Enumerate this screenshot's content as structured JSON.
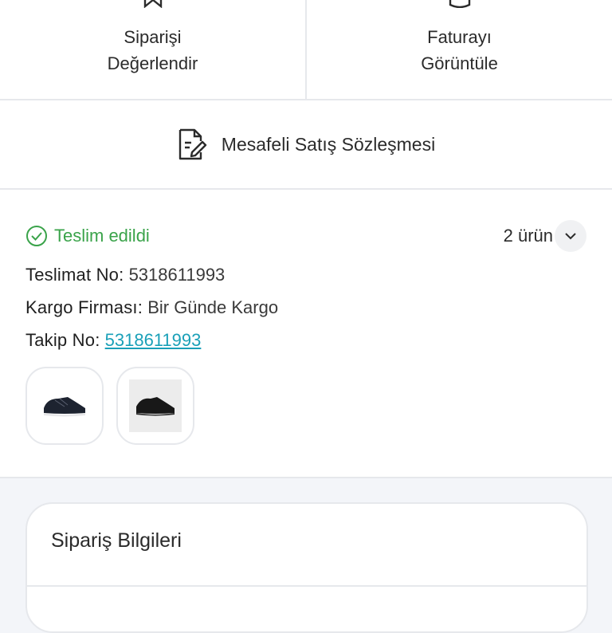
{
  "actions": {
    "rate": {
      "line1": "Siparişi",
      "line2": "Değerlendir",
      "icon": "bookmark-icon"
    },
    "invoice": {
      "line1": "Faturayı",
      "line2": "Görüntüle",
      "icon": "receipt-icon"
    }
  },
  "contract": {
    "label": "Mesafeli Satış Sözleşmesi",
    "icon": "document-edit-icon"
  },
  "shipment": {
    "status": "Teslim edildi",
    "status_color": "#3aa34a",
    "item_count": "2 ürün",
    "delivery_label": "Teslimat No:",
    "delivery_value": "5318611993",
    "carrier_label": "Kargo Firması:",
    "carrier_value": "Bir Günde Kargo",
    "tracking_label": "Takip No:",
    "tracking_value": "5318611993",
    "link_color": "#1aa0b8"
  },
  "order_info": {
    "title": "Sipariş Bilgileri"
  }
}
